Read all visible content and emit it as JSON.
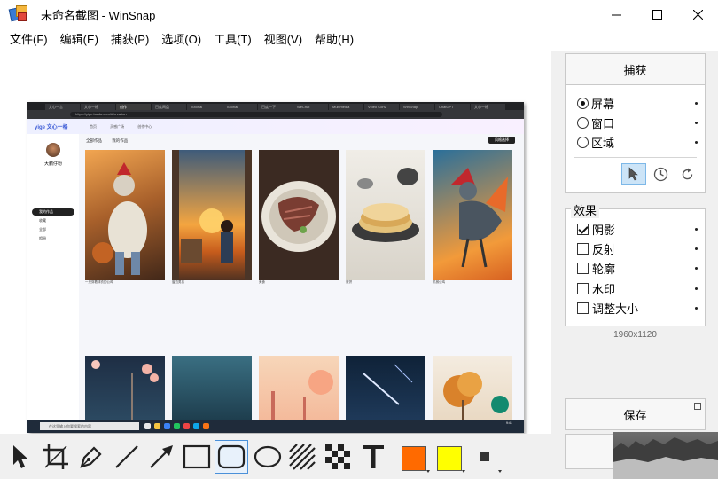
{
  "window": {
    "title": "未命名截图 - WinSnap",
    "controls": {
      "minimize": "minimize",
      "maximize": "maximize",
      "close": "close"
    }
  },
  "menu": [
    "文件(F)",
    "编辑(E)",
    "捕获(P)",
    "选项(O)",
    "工具(T)",
    "视图(V)",
    "帮助(H)"
  ],
  "capture_button": "捕获",
  "capture_modes": [
    {
      "label": "屏幕",
      "selected": true
    },
    {
      "label": "窗口",
      "selected": false
    },
    {
      "label": "区域",
      "selected": false
    }
  ],
  "effects_title": "效果",
  "effects": [
    {
      "label": "阴影",
      "checked": true
    },
    {
      "label": "反射",
      "checked": false
    },
    {
      "label": "轮廓",
      "checked": false
    },
    {
      "label": "水印",
      "checked": false
    },
    {
      "label": "调整大小",
      "checked": false
    }
  ],
  "image_size": "1960x1120",
  "save_button": "保存",
  "colors": {
    "primary": "#ff6a00",
    "secondary": "#ffff00",
    "accent": "#3a7bd5"
  },
  "screenshot": {
    "browser_tabs": [
      "文心一言",
      "文心一格",
      "创作",
      "百度网盘",
      "Tutorial",
      "Tutorial",
      "百度一下",
      "WeChat",
      "Multimedia",
      "Video Conv",
      "WinSnap",
      "ChatGPT",
      "文心一格"
    ],
    "url": "https://yige.baidu.com/#/creation",
    "logo": "yige 文心一格",
    "nav": [
      "首页",
      "灵感广场",
      "创作中心"
    ],
    "user_name": "大鹏仔粉",
    "side_items": [
      "我的作品",
      "收藏",
      "全部",
      "相册"
    ],
    "content_tabs": [
      "全部作品",
      "我的作品"
    ],
    "action_button": "风格选择",
    "captions": [
      "一只穿着球衣的公鸡",
      "窗边男孩",
      "美食",
      "煎饼",
      "机械公鸡"
    ],
    "taskbar_search": "在这里输入你要搜索的内容",
    "time": "9:41"
  }
}
